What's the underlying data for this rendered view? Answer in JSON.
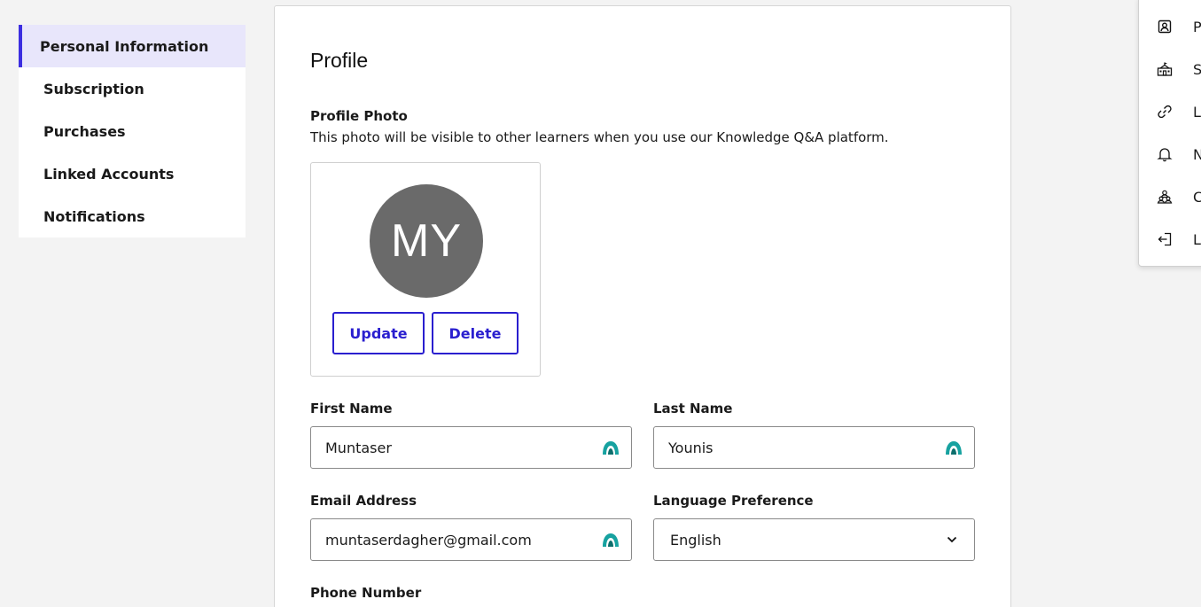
{
  "sidebar": {
    "items": [
      {
        "label": "Personal Information",
        "active": true
      },
      {
        "label": "Subscription"
      },
      {
        "label": "Purchases"
      },
      {
        "label": "Linked Accounts"
      },
      {
        "label": "Notifications"
      }
    ]
  },
  "profile": {
    "title": "Profile",
    "photo_label": "Profile Photo",
    "photo_description": "This photo will be visible to other learners when you use our Knowledge Q&A platform.",
    "avatar_initials": "MY",
    "update_label": "Update",
    "delete_label": "Delete"
  },
  "form": {
    "first_name_label": "First Name",
    "first_name_value": "Muntaser",
    "last_name_label": "Last Name",
    "last_name_value": "Younis",
    "email_label": "Email Address",
    "email_value": "muntaserdagher@gmail.com",
    "language_label": "Language Preference",
    "language_value": "English",
    "phone_label": "Phone Number"
  },
  "account_menu": {
    "items": [
      {
        "label": "P",
        "icon": "profile-icon"
      },
      {
        "label": "S",
        "icon": "school-icon"
      },
      {
        "label": "L",
        "icon": "link-icon"
      },
      {
        "label": "N",
        "icon": "bell-icon"
      },
      {
        "label": "C",
        "icon": "community-icon"
      },
      {
        "label": "Lo",
        "icon": "logout-icon"
      }
    ]
  },
  "colors": {
    "accent": "#2a1fcf",
    "active_nav_bg": "#e8e6fb",
    "avatar_bg": "#6a6a6a",
    "autofill_teal": "#17a2a0"
  }
}
